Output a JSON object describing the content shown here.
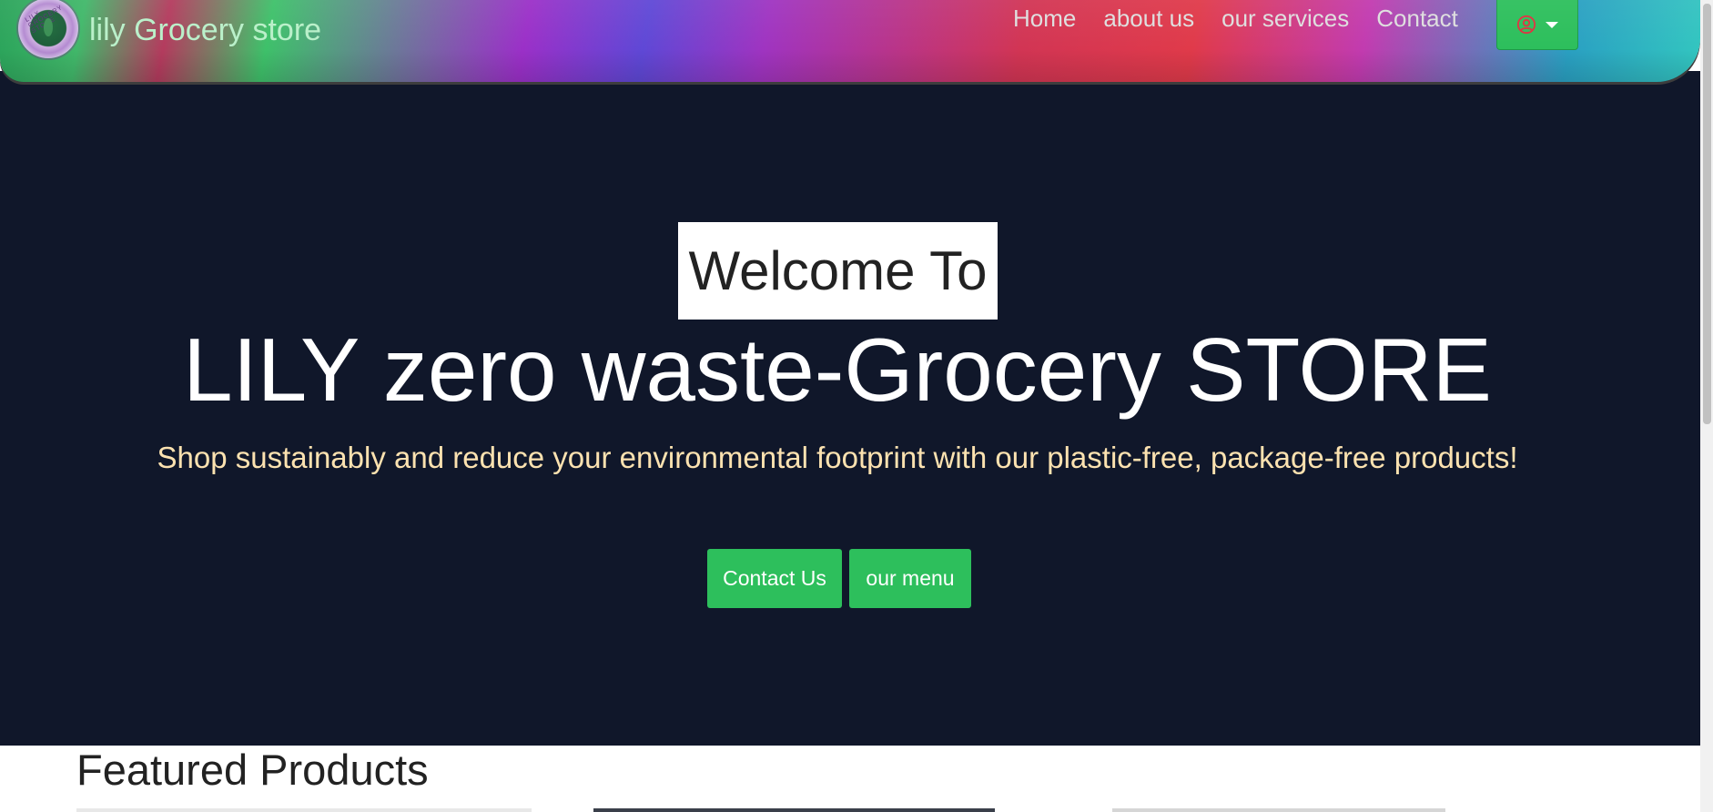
{
  "navbar": {
    "brand_name": "lily Grocery store",
    "logo_ring_text": "LILY GROCERY STORE",
    "links": [
      {
        "label": "Home"
      },
      {
        "label": "about us"
      },
      {
        "label": "our services"
      },
      {
        "label": "Contact"
      }
    ],
    "user_menu_icon": "user-circle-icon",
    "user_menu_caret": "caret-down-icon"
  },
  "hero": {
    "welcome": "Welcome To",
    "title": "LILY zero waste-Grocery STORE",
    "subtitle": "Shop sustainably and reduce your environmental footprint with our plastic-free, package-free products!",
    "buttons": {
      "contact": "Contact Us",
      "menu": "our menu"
    }
  },
  "featured": {
    "title": "Featured Products"
  },
  "colors": {
    "hero_bg": "#10172a",
    "accent_green": "#2dbf5c",
    "subtitle": "#fce2b0",
    "user_icon": "#e03040"
  }
}
